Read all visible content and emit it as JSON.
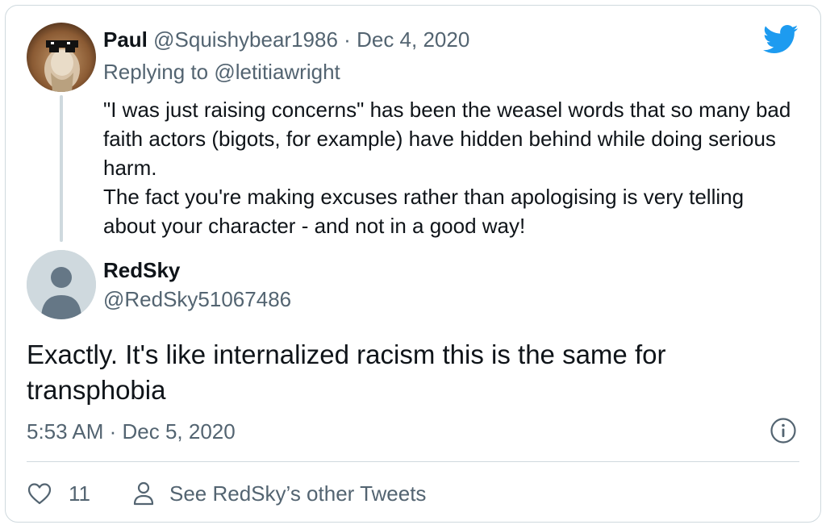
{
  "quoted_tweet": {
    "author_name": "Paul",
    "author_handle": "@Squishybear1986",
    "separator": "·",
    "date": "Dec 4, 2020",
    "replying_prefix": "Replying to ",
    "replying_to": "@letitiawright",
    "paragraphs": [
      "\"I was just raising concerns\" has been the weasel words that so many bad faith actors (bigots, for example) have hidden behind while doing serious harm.",
      "The fact you're making excuses rather than apologising is very telling about your character - and not in a good way!"
    ]
  },
  "main_tweet": {
    "author_name": "RedSky",
    "author_handle": "@RedSky51067486",
    "text": "Exactly. It's like internalized racism this is the same for transphobia",
    "timestamp": "5:53 AM · Dec 5, 2020"
  },
  "actions": {
    "like_count": "11",
    "other_tweets_label": "See RedSky’s other Tweets"
  },
  "colors": {
    "twitter_blue": "#1d9bf0",
    "muted_text": "#536471",
    "border": "#cfd9de"
  },
  "icons": [
    "twitter-bird-icon",
    "info-icon",
    "heart-icon",
    "person-icon"
  ]
}
